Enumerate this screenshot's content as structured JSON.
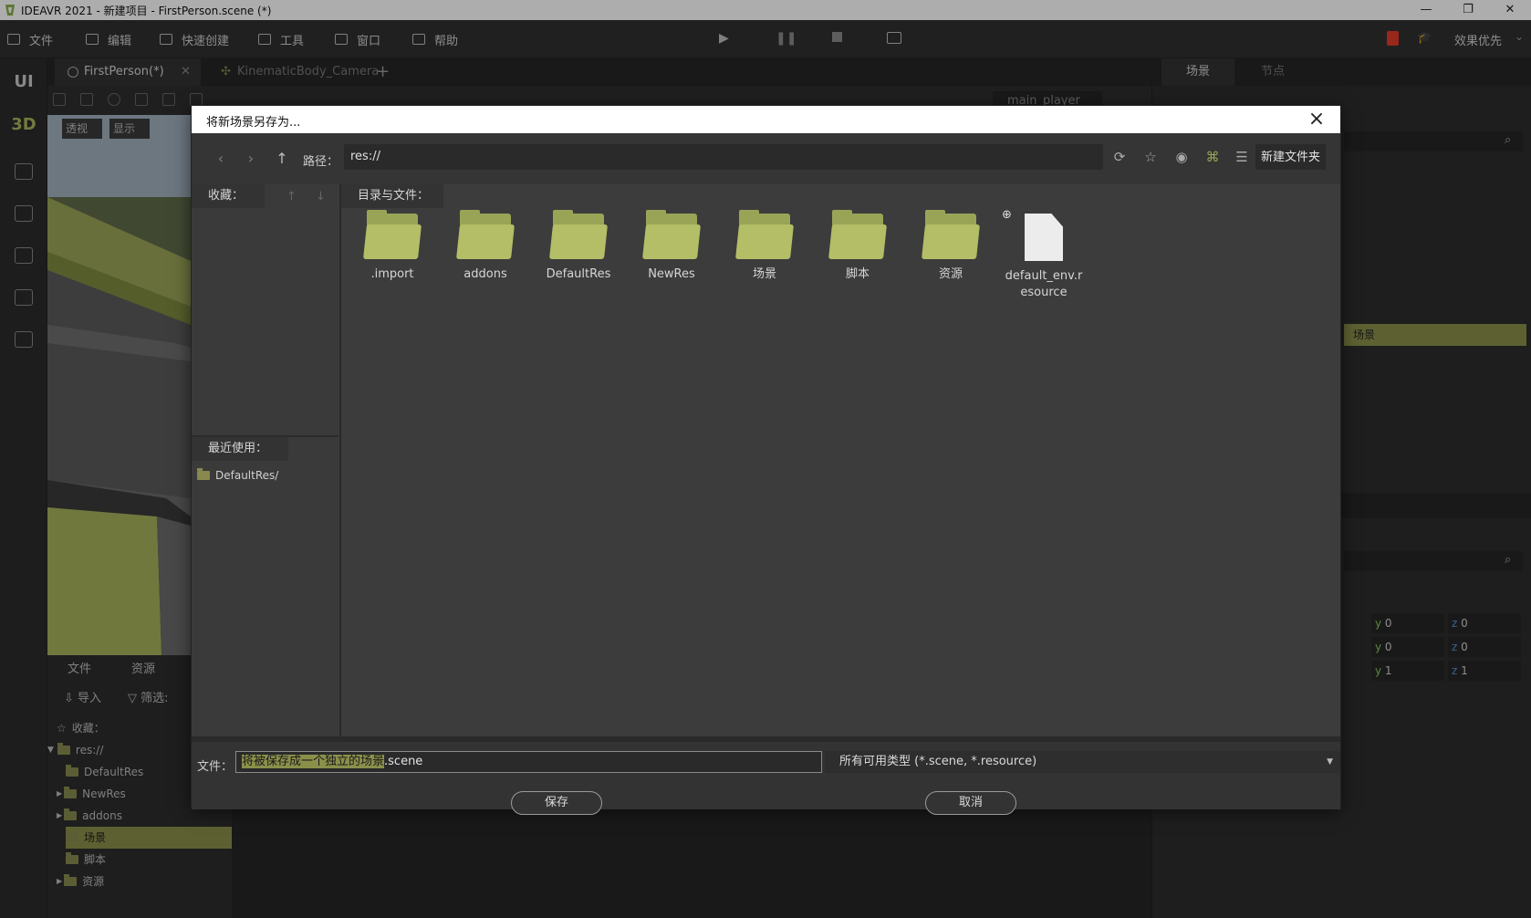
{
  "window": {
    "title": "IDEAVR 2021 - 新建项目 - FirstPerson.scene (*)",
    "minimize": "—",
    "maximize": "❐",
    "close": "✕"
  },
  "menubar": {
    "items": [
      "文件",
      "编辑",
      "快速创建",
      "工具",
      "窗口",
      "帮助"
    ],
    "quality": "效果优先"
  },
  "leftbar": {
    "ui": "UI",
    "d3": "3D"
  },
  "editor": {
    "tabs": [
      "FirstPerson(*)",
      "KinematicBody_Camera"
    ],
    "viewport_buttons": [
      "透视",
      "显示"
    ],
    "player_select": "main_player"
  },
  "filepanel": {
    "tabs": [
      "文件",
      "资源"
    ],
    "import": "导入",
    "filter": "筛选:",
    "favorites": "收藏：",
    "tree": [
      "res://",
      "DefaultRes",
      "NewRes",
      "addons",
      "场景",
      "脚本",
      "资源"
    ]
  },
  "rightdock": {
    "tabs": [
      "场景",
      "节点"
    ],
    "selected": "场景",
    "transform": [
      {
        "y": "0",
        "z": "0"
      },
      {
        "y": "0",
        "z": "0"
      },
      {
        "y": "1",
        "z": "1"
      }
    ]
  },
  "dialog": {
    "title": "将新场景另存为...",
    "path_label": "路径：",
    "path": "res://",
    "new_folder": "新建文件夹",
    "favorites_label": "收藏：",
    "recent_label": "最近使用：",
    "recent_items": [
      "DefaultRes/"
    ],
    "dir_label": "目录与文件：",
    "items": [
      {
        "name": ".import",
        "kind": "folder"
      },
      {
        "name": "addons",
        "kind": "folder"
      },
      {
        "name": "DefaultRes",
        "kind": "folder"
      },
      {
        "name": "NewRes",
        "kind": "folder"
      },
      {
        "name": "场景",
        "kind": "folder"
      },
      {
        "name": "脚本",
        "kind": "folder"
      },
      {
        "name": "资源",
        "kind": "folder"
      },
      {
        "name": "default_env.resource",
        "kind": "file"
      }
    ],
    "file_label": "文件：",
    "file_selected": "将被保存成一个独立的场景",
    "file_ext": ".scene",
    "type_filter": "所有可用类型 (*.scene, *.resource)",
    "save": "保存",
    "cancel": "取消"
  },
  "colors": {
    "accent": "#8a8f4a",
    "folder": "#b3be67"
  }
}
